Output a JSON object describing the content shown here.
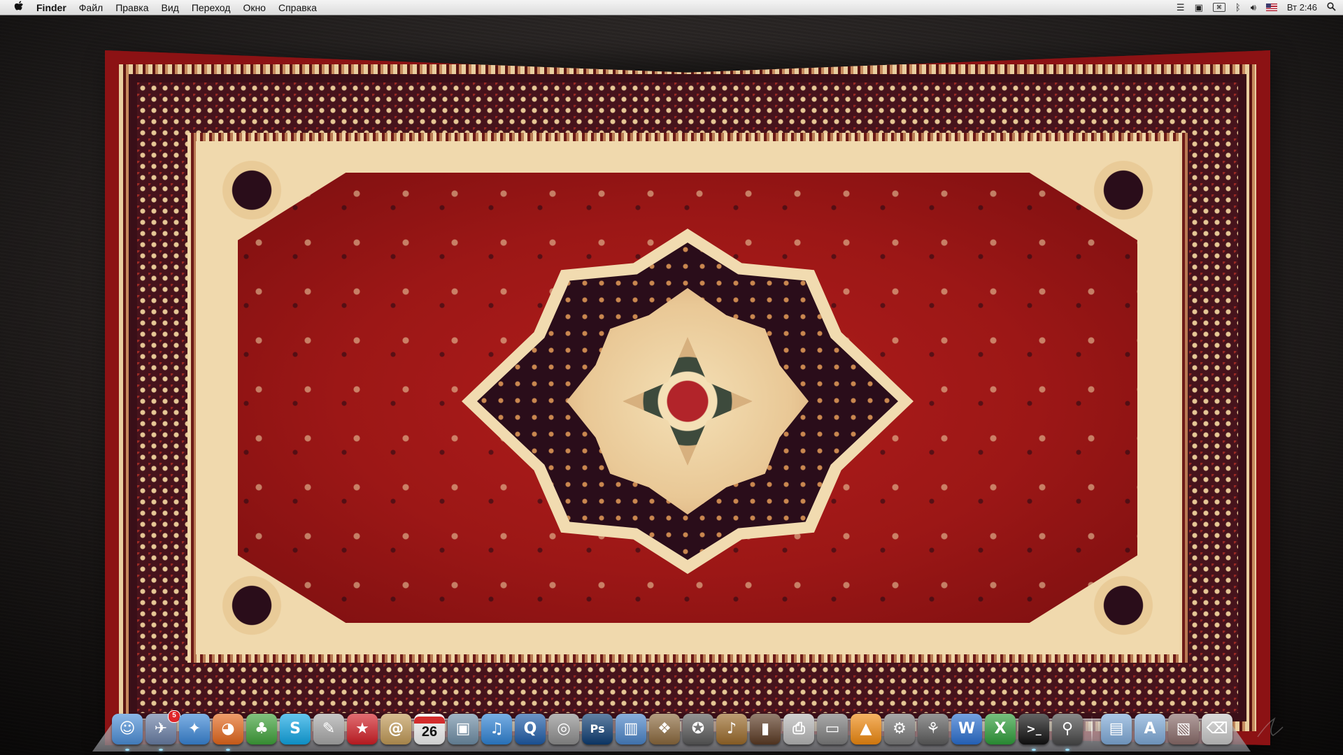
{
  "menubar": {
    "app_name": "Finder",
    "menus": [
      "Файл",
      "Правка",
      "Вид",
      "Переход",
      "Окно",
      "Справка"
    ],
    "clock": "Вт 2:46"
  },
  "status_icons": [
    "stacked-bars-icon",
    "screen-icon",
    "bluetooth-icon",
    "keyboard-layout-icon",
    "volume-icon",
    "us-flag-icon",
    "spotlight-search-icon"
  ],
  "dock": {
    "apps": [
      {
        "id": "finder",
        "icon": "finder-icon",
        "bg": "#4c8fd8",
        "glyph": "☺",
        "running": true
      },
      {
        "id": "mail",
        "icon": "mail-stamp-icon",
        "bg": "#6a7fa6",
        "glyph": "✈",
        "badge": "5",
        "running": true
      },
      {
        "id": "safari",
        "icon": "safari-compass-icon",
        "bg": "#3a86d6",
        "glyph": "✦",
        "running": false
      },
      {
        "id": "firefox",
        "icon": "firefox-icon",
        "bg": "#e5681c",
        "glyph": "◕",
        "running": true
      },
      {
        "id": "adium",
        "icon": "duck-icon",
        "bg": "#3fa23a",
        "glyph": "♣",
        "running": false
      },
      {
        "id": "skype",
        "icon": "skype-icon",
        "bg": "#11a6e4",
        "glyph": "S",
        "running": false
      },
      {
        "id": "script",
        "icon": "script-editor-icon",
        "bg": "#a9a9a9",
        "glyph": "✎",
        "running": false
      },
      {
        "id": "pokerstars",
        "icon": "pokerstars-icon",
        "bg": "#d21f26",
        "glyph": "★",
        "running": false
      },
      {
        "id": "addressbook",
        "icon": "address-book-icon",
        "bg": "#c19a57",
        "glyph": "@",
        "running": false
      },
      {
        "id": "ical",
        "icon": "calendar-icon",
        "bg": "#f2f2f2",
        "day": "26",
        "running": false
      },
      {
        "id": "preview",
        "icon": "preview-icon",
        "bg": "#6f8ea6",
        "glyph": "▣",
        "running": false
      },
      {
        "id": "itunes",
        "icon": "itunes-icon",
        "bg": "#2f83d5",
        "glyph": "♫",
        "running": false
      },
      {
        "id": "quicktime",
        "icon": "quicktime-icon",
        "bg": "#1f5ca8",
        "glyph": "Q",
        "running": false
      },
      {
        "id": "dvd",
        "icon": "dvd-player-icon",
        "bg": "#8f8f8f",
        "glyph": "◎",
        "running": false
      },
      {
        "id": "photoshop",
        "icon": "photoshop-icon",
        "bg": "#0d3d73",
        "glyph": "Ps",
        "running": false
      },
      {
        "id": "network",
        "icon": "network-folder-icon",
        "bg": "#4a84c8",
        "glyph": "▥",
        "running": false
      },
      {
        "id": "iphoto",
        "icon": "iphoto-icon",
        "bg": "#8c6a3e",
        "glyph": "❖",
        "running": false
      },
      {
        "id": "imovie",
        "icon": "imovie-star-icon",
        "bg": "#5a5a5a",
        "glyph": "✪",
        "running": false
      },
      {
        "id": "garageband",
        "icon": "guitar-icon",
        "bg": "#9a6a2a",
        "glyph": "♪",
        "running": false
      },
      {
        "id": "books",
        "icon": "books-icon",
        "bg": "#5c3b24",
        "glyph": "▮",
        "running": false
      },
      {
        "id": "printer",
        "icon": "hp-printer-icon",
        "bg": "#b8b8b8",
        "glyph": "⎙",
        "running": false
      },
      {
        "id": "drive",
        "icon": "hard-drive-icon",
        "bg": "#7d7d7d",
        "glyph": "▭",
        "running": false
      },
      {
        "id": "vlc",
        "icon": "vlc-cone-icon",
        "bg": "#f08a10",
        "glyph": "▲",
        "running": false
      },
      {
        "id": "sysprefs",
        "icon": "system-preferences-gear-icon",
        "bg": "#7a7a7a",
        "glyph": "⚙",
        "running": false
      },
      {
        "id": "steam",
        "icon": "steam-icon",
        "bg": "#5e5e5e",
        "glyph": "⚘",
        "running": false
      },
      {
        "id": "word",
        "icon": "word-icon",
        "bg": "#2a6fd0",
        "glyph": "W",
        "running": false
      },
      {
        "id": "excel",
        "icon": "excel-icon",
        "bg": "#2f9e3a",
        "glyph": "X",
        "running": false
      },
      {
        "id": "terminal",
        "icon": "terminal-icon",
        "bg": "#111111",
        "glyph": ">_",
        "running": true
      },
      {
        "id": "cs",
        "icon": "counter-strike-icon",
        "bg": "#4a4a4a",
        "glyph": "⚲",
        "running": true
      }
    ],
    "stacks": [
      {
        "id": "documents",
        "icon": "documents-folder-icon",
        "bg": "#7faad8",
        "glyph": "▤",
        "running": false
      },
      {
        "id": "applications",
        "icon": "applications-folder-icon",
        "bg": "#7faad8",
        "glyph": "A",
        "running": false
      },
      {
        "id": "downloads",
        "icon": "downloads-stack-icon",
        "bg": "#8a6c6a",
        "glyph": "▧",
        "running": false
      },
      {
        "id": "trash",
        "icon": "trash-icon",
        "bg": "#c8c8c8",
        "glyph": "⌫",
        "running": false
      }
    ]
  }
}
